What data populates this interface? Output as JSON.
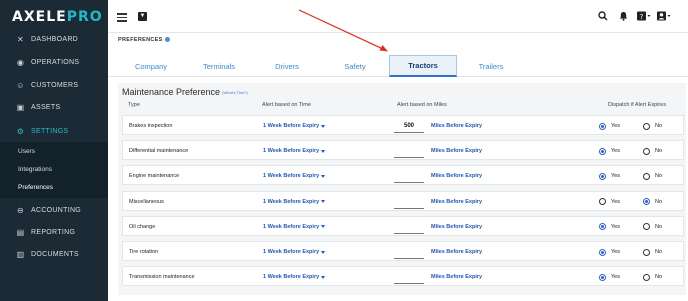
{
  "app": {
    "logo_main": "AXELE",
    "logo_accent": "PRO"
  },
  "sidebar": {
    "items": [
      {
        "label": "DASHBOARD",
        "icon": "dashboard-icon"
      },
      {
        "label": "OPERATIONS",
        "icon": "operations-icon"
      },
      {
        "label": "CUSTOMERS",
        "icon": "customers-icon"
      },
      {
        "label": "ASSETS",
        "icon": "assets-icon"
      },
      {
        "label": "SETTINGS",
        "icon": "gear-icon"
      },
      {
        "label": "ACCOUNTING",
        "icon": "accounting-icon"
      },
      {
        "label": "REPORTING",
        "icon": "reporting-icon"
      },
      {
        "label": "DOCUMENTS",
        "icon": "documents-icon"
      }
    ],
    "sub_items": [
      "Users",
      "Integrations",
      "Preferences"
    ],
    "active_color": "#24c0c9",
    "bg_color": "#1b2a35"
  },
  "topbar": {
    "icons": [
      "menu-icon",
      "filter-icon",
      "search-icon",
      "bell-icon",
      "help-icon",
      "user-icon"
    ]
  },
  "page": {
    "title": "PREFERENCES",
    "tabs": [
      "Company",
      "Terminals",
      "Drivers",
      "Safety",
      "Tractors",
      "Trailers"
    ],
    "active_tab": "Tractors"
  },
  "panel": {
    "title": "Maintenance Preference",
    "whats_this": "(What's This?)",
    "headers": {
      "type": "Type",
      "alert_time": "Alert based on Time",
      "alert_miles": "Alert based on Miles",
      "dispatch": "Dispatch if Alert Expires"
    },
    "yes_label": "Yes",
    "no_label": "No",
    "miles_label": "Miles Before Expiry",
    "rows": [
      {
        "type": "Brakes inspection",
        "time_alert": "1 Week Before Expiry",
        "miles": "500",
        "dispatch": "Yes"
      },
      {
        "type": "Differential maintenance",
        "time_alert": "1 Week Before Expiry",
        "miles": "",
        "dispatch": "Yes"
      },
      {
        "type": "Engine maintenance",
        "time_alert": "1 Week Before Expiry",
        "miles": "",
        "dispatch": "Yes"
      },
      {
        "type": "Miscellaneous",
        "time_alert": "1 Week Before Expiry",
        "miles": "",
        "dispatch": "No"
      },
      {
        "type": "Oil change",
        "time_alert": "1 Week Before Expiry",
        "miles": "",
        "dispatch": "Yes"
      },
      {
        "type": "Tire rotation",
        "time_alert": "1 Week Before Expiry",
        "miles": "",
        "dispatch": "Yes"
      },
      {
        "type": "Transmission maintenance",
        "time_alert": "1 Week Before Expiry",
        "miles": "",
        "dispatch": "Yes"
      }
    ]
  },
  "annotation": {
    "arrow_color": "#e8271f"
  }
}
